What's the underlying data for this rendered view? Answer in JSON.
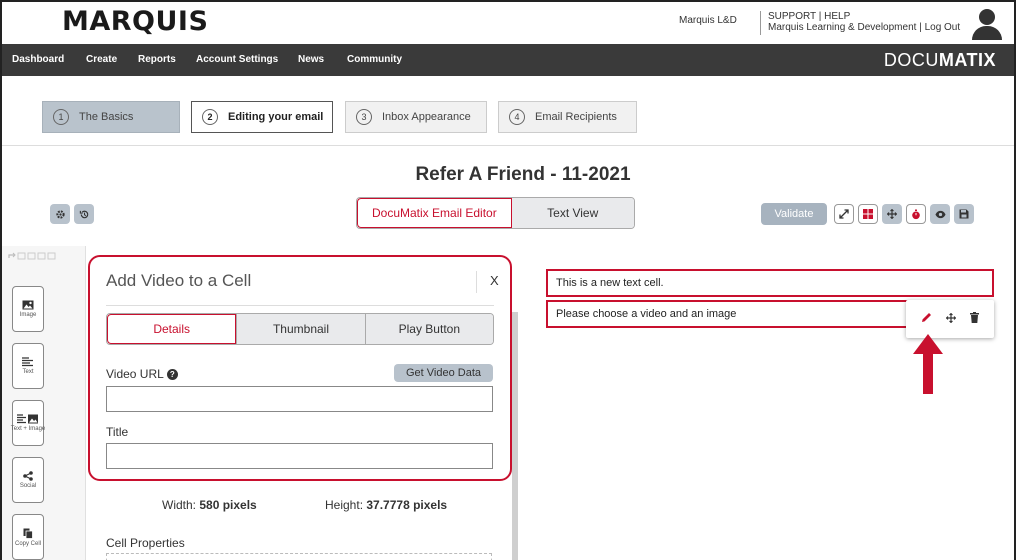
{
  "header": {
    "logo": "MARQUIS",
    "org_name": "Marquis L&D",
    "support_line1": "SUPPORT | HELP",
    "support_line2": "Marquis Learning & Development | Log Out"
  },
  "nav": {
    "items": [
      "Dashboard",
      "Create",
      "Reports",
      "Account Settings",
      "News",
      "Community"
    ],
    "brand_prefix": "DOCU",
    "brand_suffix": "MATIX"
  },
  "steps": [
    {
      "num": "1",
      "label": "The Basics"
    },
    {
      "num": "2",
      "label": "Editing your email"
    },
    {
      "num": "3",
      "label": "Inbox Appearance"
    },
    {
      "num": "4",
      "label": "Email Recipients"
    }
  ],
  "email_title": "Refer A Friend - 11-2021",
  "mode_toggle": {
    "editor": "DocuMatix Email Editor",
    "text_view": "Text View"
  },
  "validate_label": "Validate",
  "tool_blocks": [
    {
      "icon": "image-icon",
      "label": "Image"
    },
    {
      "icon": "text-icon",
      "label": "Text"
    },
    {
      "icon": "text-image-icon",
      "label": "Text + Image"
    },
    {
      "icon": "share-icon",
      "label": "Social"
    },
    {
      "icon": "copy-icon",
      "label": "Copy Cell"
    }
  ],
  "dialog": {
    "title": "Add Video to a Cell",
    "close": "X",
    "tabs": [
      "Details",
      "Thumbnail",
      "Play Button"
    ],
    "video_url_label": "Video URL",
    "get_video_data": "Get Video Data",
    "title_label": "Title",
    "video_url_value": "",
    "title_value": ""
  },
  "dimensions": {
    "width_label": "Width:",
    "width_value": "580 pixels",
    "height_label": "Height:",
    "height_value": "37.7778 pixels"
  },
  "cell_properties_label": "Cell Properties",
  "canvas": {
    "cell1_text": "This is a new text cell.",
    "cell2_text": "Please choose a video and an image"
  },
  "colors": {
    "accent": "#c8102e",
    "nav_bg": "#3a3a3a",
    "button_gray": "#b8c2cc"
  }
}
